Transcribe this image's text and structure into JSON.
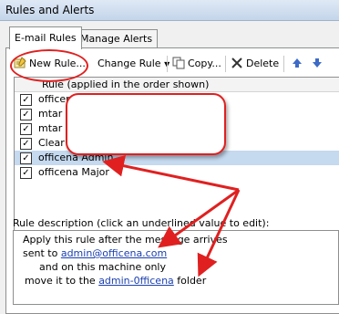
{
  "window": {
    "title": "Rules and Alerts"
  },
  "tabs": [
    {
      "label": "E-mail Rules",
      "active": true
    },
    {
      "label": "Manage Alerts",
      "active": false
    }
  ],
  "toolbar": {
    "new_rule": "New Rule...",
    "change_rule": "Change Rule",
    "copy": "Copy...",
    "delete": "Delete"
  },
  "rules_list": {
    "header": "Rule (applied in the order shown)",
    "items": [
      {
        "label": "officena",
        "checked": true
      },
      {
        "label": "mtar",
        "checked": true
      },
      {
        "label": "mtar",
        "checked": true
      },
      {
        "label": "Clear c",
        "checked": true
      },
      {
        "label": "officena Admin",
        "checked": true,
        "selected": true
      },
      {
        "label": "officena Major",
        "checked": true
      }
    ]
  },
  "description": {
    "label": "Rule description (click an underlined value to edit):",
    "line1": "Apply this rule after the message arrives",
    "line2_prefix": "sent to ",
    "line2_link": "admin@officena.com",
    "line3": "and on this machine only",
    "line4_prefix": "move it to the ",
    "line4_link": "admin-0fficena",
    "line4_suffix": " folder"
  },
  "colors": {
    "annotation": "#e02020",
    "selection": "#c5d9ef",
    "link": "#1a3fb0"
  }
}
